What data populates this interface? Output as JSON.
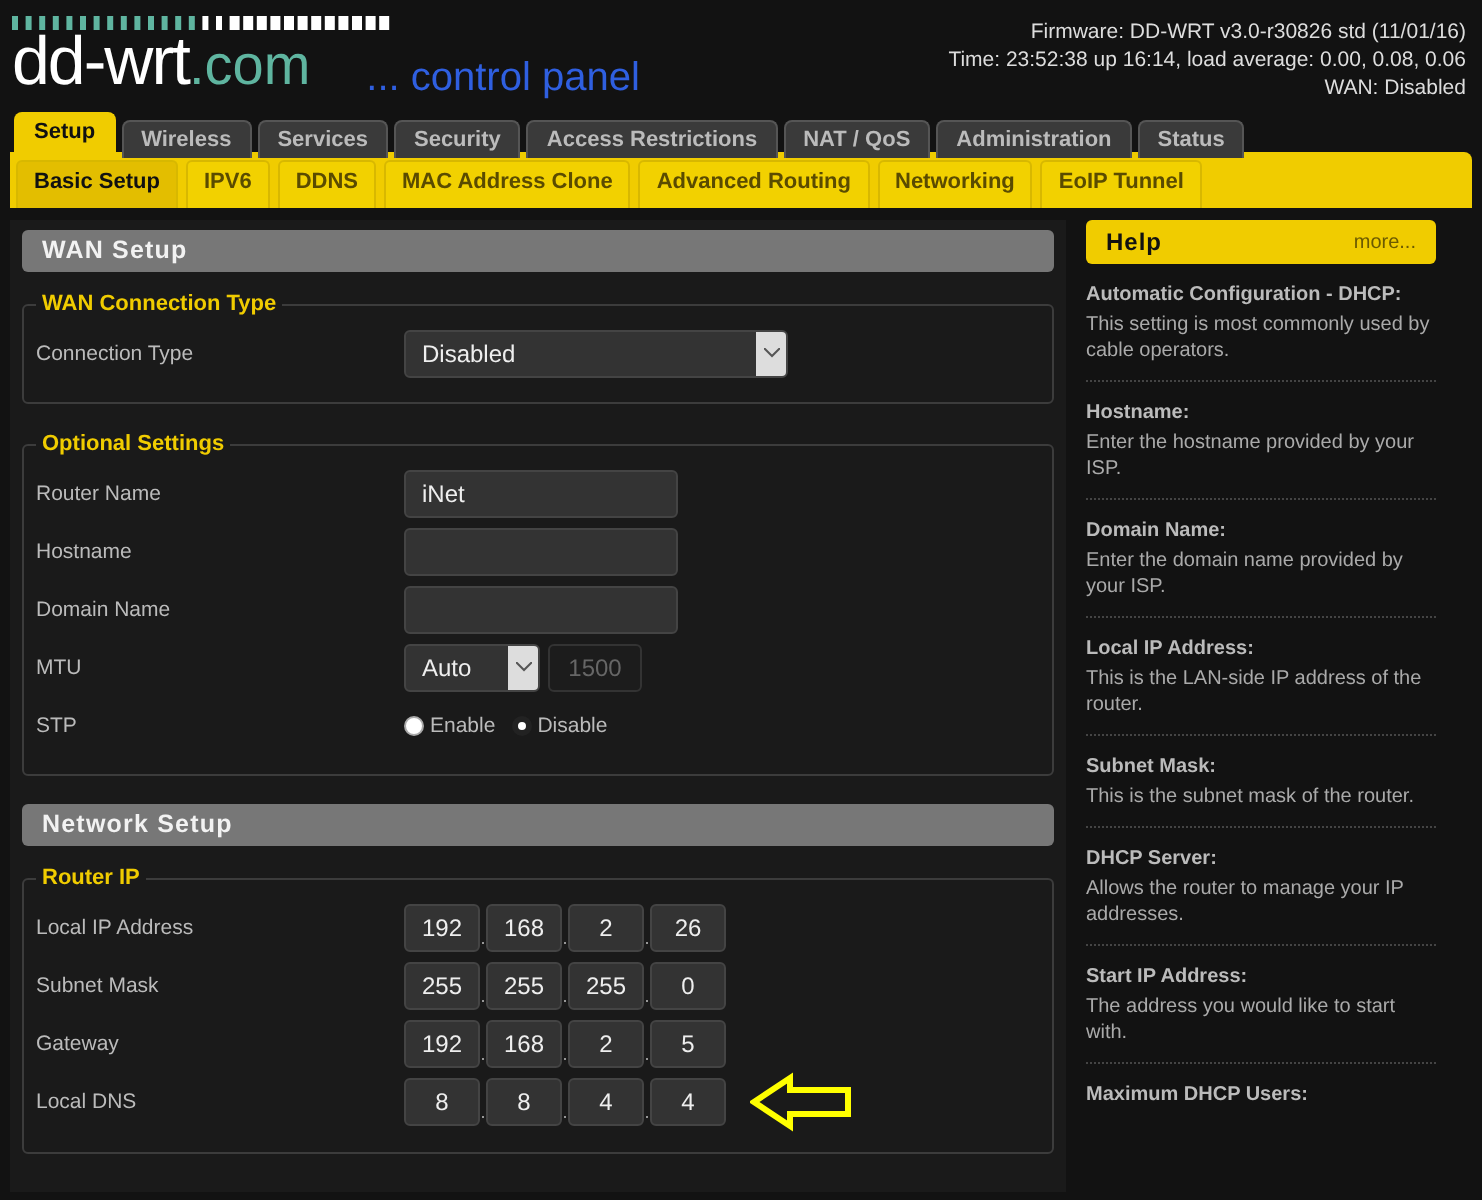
{
  "header": {
    "logo": {
      "name": "dd-wrt",
      "domain": ".com"
    },
    "tagline": "... control panel",
    "info": [
      "Firmware: DD-WRT v3.0-r30826 std (11/01/16)",
      "Time: 23:52:38 up 16:14, load average: 0.00, 0.08, 0.06",
      "WAN: Disabled"
    ]
  },
  "tabs": [
    {
      "label": "Setup",
      "selected": true
    },
    {
      "label": "Wireless",
      "selected": false
    },
    {
      "label": "Services",
      "selected": false
    },
    {
      "label": "Security",
      "selected": false
    },
    {
      "label": "Access Restrictions",
      "selected": false
    },
    {
      "label": "NAT / QoS",
      "selected": false
    },
    {
      "label": "Administration",
      "selected": false
    },
    {
      "label": "Status",
      "selected": false
    }
  ],
  "subtabs": [
    {
      "label": "Basic Setup",
      "selected": true
    },
    {
      "label": "IPV6",
      "selected": false
    },
    {
      "label": "DDNS",
      "selected": false
    },
    {
      "label": "MAC Address Clone",
      "selected": false
    },
    {
      "label": "Advanced Routing",
      "selected": false
    },
    {
      "label": "Networking",
      "selected": false
    },
    {
      "label": "EoIP Tunnel",
      "selected": false
    }
  ],
  "sections": [
    {
      "title": "WAN Setup",
      "groups": [
        {
          "legend": "WAN Connection Type",
          "rows": [
            {
              "label": "Connection Type",
              "kind": "select",
              "value": "Disabled"
            }
          ]
        },
        {
          "legend": "Optional Settings",
          "rows": [
            {
              "label": "Router Name",
              "kind": "text",
              "value": "iNet"
            },
            {
              "label": "Hostname",
              "kind": "text"
            },
            {
              "label": "Domain Name",
              "kind": "text"
            },
            {
              "label": "MTU",
              "kind": "mtu",
              "value": "Auto",
              "number": "1500"
            },
            {
              "label": "STP",
              "kind": "radio",
              "options": [
                {
                  "label": "Enable",
                  "selected": false
                },
                {
                  "label": "Disable",
                  "selected": true
                }
              ]
            }
          ]
        }
      ]
    },
    {
      "title": "Network Setup",
      "groups": [
        {
          "legend": "Router IP",
          "rows": [
            {
              "label": "Local IP Address",
              "kind": "ip",
              "octets": [
                "192",
                "168",
                "2",
                "26"
              ],
              "dots": [
                ".",
                ".",
                "."
              ]
            },
            {
              "label": "Subnet Mask",
              "kind": "ip",
              "octets": [
                "255",
                "255",
                "255",
                "0"
              ],
              "dots": [
                ".",
                ".",
                "."
              ]
            },
            {
              "label": "Gateway",
              "kind": "ip",
              "octets": [
                "192",
                "168",
                "2",
                "5"
              ],
              "dots": [
                ".",
                ".",
                "."
              ]
            },
            {
              "label": "Local DNS",
              "kind": "ip",
              "octets": [
                "8",
                "8",
                "4",
                "4"
              ],
              "dots": [
                ".",
                ".",
                "."
              ],
              "pointer": true
            }
          ]
        }
      ]
    }
  ],
  "help": {
    "title": "Help",
    "more": "more...",
    "items": [
      {
        "heading": "Automatic Configuration - DHCP:",
        "text": "This setting is most commonly used by cable operators."
      },
      {
        "heading": "Hostname:",
        "text": "Enter the hostname provided by your ISP."
      },
      {
        "heading": "Domain Name:",
        "text": "Enter the domain name provided by your ISP."
      },
      {
        "heading": "Local IP Address:",
        "text": "This is the LAN-side IP address of the router."
      },
      {
        "heading": "Subnet Mask:",
        "text": "This is the subnet mask of the router."
      },
      {
        "heading": "DHCP Server:",
        "text": "Allows the router to manage your IP addresses."
      },
      {
        "heading": "Start IP Address:",
        "text": "The address you would like to start with."
      },
      {
        "heading": "Maximum DHCP Users:"
      }
    ]
  }
}
